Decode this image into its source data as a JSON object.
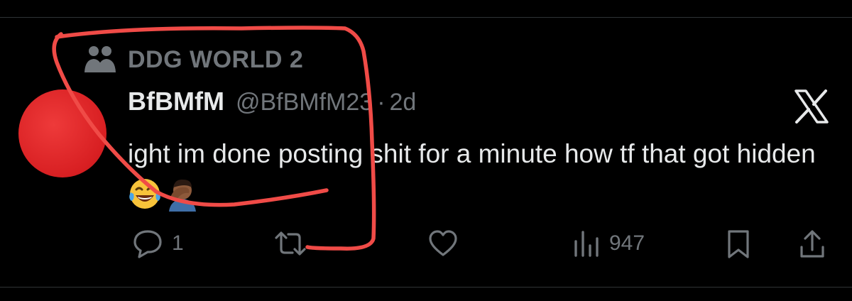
{
  "community": {
    "name": "DDG WORLD 2",
    "icon": "people-icon"
  },
  "post": {
    "display_name": "BfBMfM",
    "handle": "@BfBMfM23",
    "separator": "·",
    "time": "2d",
    "text": "ight im done posting shit for a minute how tf that got hidden",
    "emojis": [
      "face-with-tears-of-joy",
      "person-facepalming"
    ]
  },
  "actions": {
    "reply_count": "1",
    "retweet_count": "",
    "like_count": "",
    "views_count": "947"
  },
  "colors": {
    "background": "#000000",
    "text": "#e7e9ea",
    "muted": "#71767b",
    "avatar": "#d81f22",
    "annotation": "#f04b47"
  },
  "icons": [
    "people-icon",
    "x-logo-icon",
    "reply-icon",
    "retweet-icon",
    "like-icon",
    "views-icon",
    "bookmark-icon",
    "share-icon"
  ]
}
